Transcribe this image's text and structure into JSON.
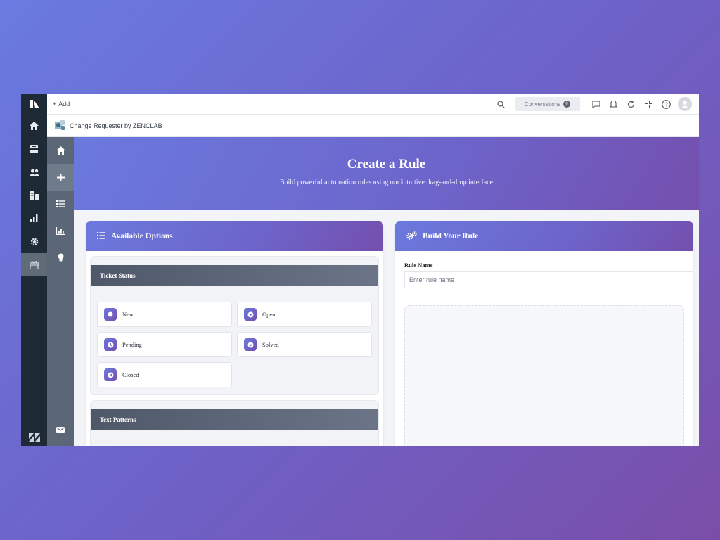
{
  "topbar": {
    "add_label": "Add",
    "conversations_label": "Conversations",
    "conversations_count": "0"
  },
  "app": {
    "title": "Change Requester by ZENCLAB"
  },
  "hero": {
    "title": "Create a Rule",
    "subtitle": "Build powerful automation rules using our intuitive drag-and-drop interface"
  },
  "available": {
    "title": "Available Options",
    "sections": [
      {
        "title": "Ticket Status",
        "options": [
          "New",
          "Open",
          "Pending",
          "Solved",
          "Closed"
        ]
      },
      {
        "title": "Text Patterns"
      }
    ]
  },
  "build": {
    "title": "Build Your Rule",
    "rule_name_label": "Rule Name",
    "rule_name_placeholder": "Enter rule name"
  },
  "colors": {
    "accent_start": "#6b79dd",
    "accent_end": "#744fae",
    "rail": "#1f2a37",
    "app_sidebar": "#5b6777"
  }
}
